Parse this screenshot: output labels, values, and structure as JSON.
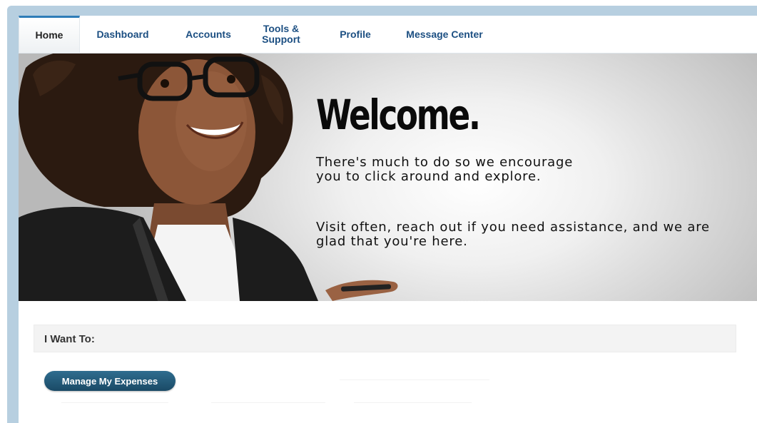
{
  "nav": {
    "items": [
      {
        "label": "Home",
        "active": true
      },
      {
        "label": "Dashboard"
      },
      {
        "label": "Accounts"
      },
      {
        "label": "Tools &\nSupport"
      },
      {
        "label": "Profile"
      },
      {
        "label": "Message Center"
      }
    ]
  },
  "hero": {
    "title": "Welcome.",
    "line1": "There's much to do so we encourage you to click around and explore.",
    "line2": "Visit often, reach out if you need assistance, and we are glad that you're here."
  },
  "actions": {
    "heading": "I Want To:",
    "manage_expenses_label": "Manage My Expenses"
  },
  "colors": {
    "nav_link": "#1c4f82",
    "active_tab_border": "#2e7db8",
    "button_bg": "#1a4a66",
    "frame": "#b7cfe0"
  }
}
